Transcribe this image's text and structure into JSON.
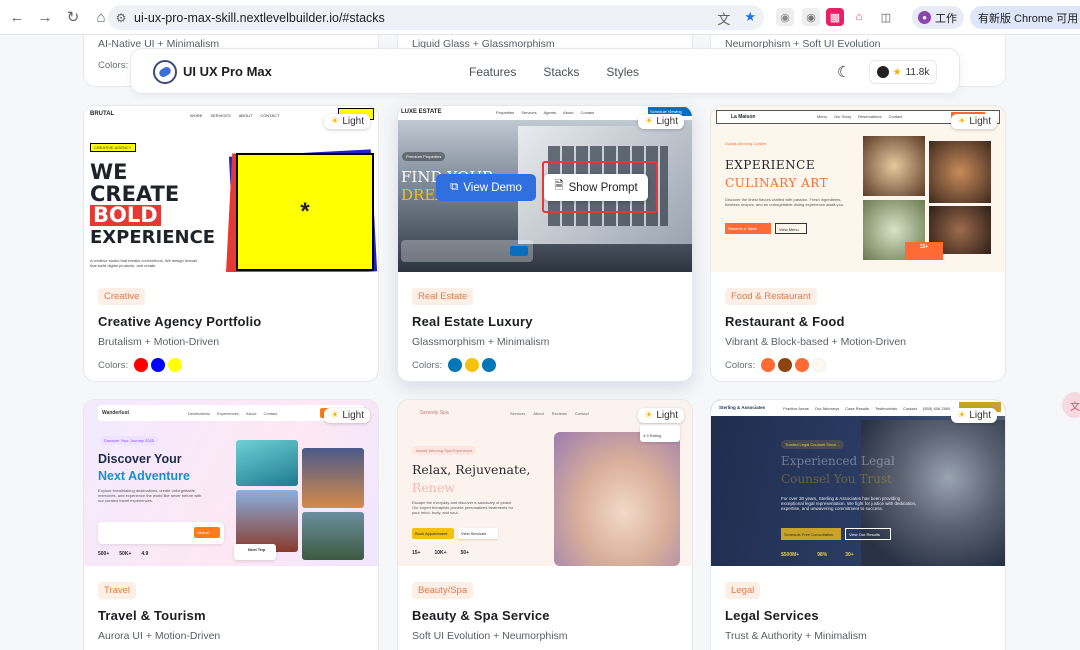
{
  "browser": {
    "url": "ui-ux-pro-max-skill.nextlevelbuilder.io/#stacks",
    "profile_label": "工作",
    "update_label": "有新版 Chrome 可用"
  },
  "site": {
    "brand": "UI UX Pro Max",
    "nav": [
      "Features",
      "Stacks",
      "Styles"
    ],
    "github_stars": "11.8k"
  },
  "partial_row": [
    {
      "subtitle": "AI-Native UI + Minimalism",
      "colors_label": "Colors:"
    },
    {
      "subtitle": "Liquid Glass + Glassmorphism",
      "colors_label": ""
    },
    {
      "subtitle": "Neumorphism + Soft UI Evolution",
      "colors_label": ""
    }
  ],
  "theme_badge": "Light",
  "hover_actions": {
    "view_demo": "View Demo",
    "show_prompt": "Show Prompt"
  },
  "cards": [
    {
      "tag": "Creative",
      "title": "Creative Agency Portfolio",
      "subtitle": "Brutalism + Motion-Driven",
      "colors_label": "Colors:",
      "colors": [
        "#ff0000",
        "#0000ff",
        "#ffff00"
      ],
      "thumb": {
        "logo": "BRUTAL",
        "nav": [
          "WORK",
          "SERVICES",
          "ABOUT",
          "CONTACT"
        ],
        "chip": "CREATIVE AGENCY",
        "h1": "WE",
        "h2": "CREATE",
        "h3": "BOLD",
        "h4": "EXPERIENCE",
        "desc": "A creative studio that breaks conventions. We design brands that build digital products, and create",
        "star": "*"
      }
    },
    {
      "tag": "Real Estate",
      "title": "Real Estate Luxury",
      "subtitle": "Glassmorphism + Minimalism",
      "colors_label": "Colors:",
      "colors": [
        "#0077b6",
        "#f4c20d",
        "#0077b6"
      ],
      "thumb": {
        "logo": "LUXE ESTATE",
        "nav": [
          "Properties",
          "Services",
          "Agents",
          "About",
          "Contact"
        ],
        "cta": "Schedule Viewing",
        "chip": "Premium Properties",
        "h1": "FIND YOUR",
        "h2": "DREAM"
      }
    },
    {
      "tag": "Food & Restaurant",
      "title": "Restaurant & Food",
      "subtitle": "Vibrant & Block-based + Motion-Driven",
      "colors_label": "Colors:",
      "colors": [
        "#ff6b35",
        "#8b4513",
        "#ff6b35",
        "#fff8f0"
      ],
      "thumb": {
        "logo": "La Maison",
        "nav": [
          "Menu",
          "Our Story",
          "Reservations",
          "Contact"
        ],
        "chip": "Award-Winning Cuisine",
        "h1": "EXPERIENCE",
        "h2": "CULINARY ART",
        "desc": "Discover the finest flavors crafted with passion. Fresh ingredients, timeless recipes, and an unforgettable dining experience await you.",
        "b1": "Reserve a Table",
        "b2": "View Menu",
        "stat": "15+"
      }
    },
    {
      "tag": "Travel",
      "title": "Travel & Tourism",
      "subtitle": "Aurora UI + Motion-Driven",
      "colors_label": "",
      "colors": [],
      "thumb": {
        "logo": "Wanderlust",
        "nav": [
          "Destinations",
          "Experiences",
          "About",
          "Contact"
        ],
        "chip": "Discover Your Journey 2025",
        "h1": "Discover Your",
        "h2": "Next Adventure",
        "desc": "Explore breathtaking destinations, create unforgettable memories, and experience the world like never before with our curated travel experiences.",
        "btn": "Search",
        "s1": "500+",
        "s2": "50K+",
        "s3": "4.9",
        "trip": "Next Trip"
      }
    },
    {
      "tag": "Beauty/Spa",
      "title": "Beauty & Spa Service",
      "subtitle": "Soft UI Evolution + Neumorphism",
      "colors_label": "",
      "colors": [],
      "thumb": {
        "logo": "Serenity Spa",
        "nav": [
          "Services",
          "About",
          "Reviews",
          "Contact"
        ],
        "chip": "Award-Winning Spa Experience",
        "h1": "Relax, Rejuvenate,",
        "h2": "Renew",
        "desc": "Escape the everyday and discover a sanctuary of peace. Our expert therapists provide personalized treatments for your mind, body, and soul.",
        "b1": "Book Appointment",
        "b2": "View Services",
        "s1": "15+",
        "s2": "10K+",
        "s3": "50+",
        "rating": "4.9 Rating"
      }
    },
    {
      "tag": "Legal",
      "title": "Legal Services",
      "subtitle": "Trust & Authority + Minimalism",
      "colors_label": "",
      "colors": [],
      "thumb": {
        "logo": "Sterling & Associates",
        "nav": [
          "Practice Areas",
          "Our Attorneys",
          "Case Results",
          "Testimonials",
          "Contact"
        ],
        "phone": "(555) 456-7890",
        "chip": "Trusted Legal Counsel Since...",
        "h1": "Experienced Legal",
        "h2": "Counsel You Trust",
        "desc": "For over 30 years, Sterling & Associates has been providing exceptional legal representation. We fight for justice with dedication, expertise, and unwavering commitment to success.",
        "b1": "Schedule Free Consultation",
        "b2": "View Our Results",
        "s1": "$500M+",
        "s2": "98%",
        "s3": "30+"
      }
    }
  ]
}
